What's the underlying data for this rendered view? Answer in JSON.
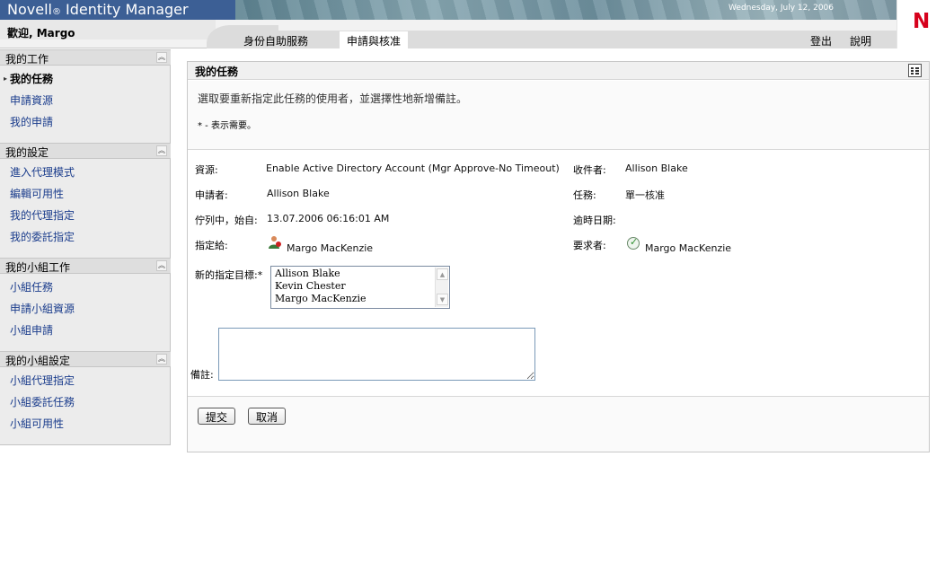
{
  "app": {
    "title": "Novell",
    "title_reg": "®",
    "title_rest": " Identity Manager",
    "date": "Wednesday, July 12, 2006",
    "logo_letter": "N"
  },
  "header": {
    "welcome": "歡迎, Margo",
    "tabs": [
      {
        "label": "身份自助服務",
        "active": false
      },
      {
        "label": "申請與核准",
        "active": true
      }
    ],
    "logout": "登出",
    "help": "說明"
  },
  "sidebar": {
    "sections": [
      {
        "title": "我的工作",
        "items": [
          "我的任務",
          "申請資源",
          "我的申請"
        ],
        "current": 0
      },
      {
        "title": "我的設定",
        "items": [
          "進入代理模式",
          "編輯可用性",
          "我的代理指定",
          "我的委託指定"
        ]
      },
      {
        "title": "我的小組工作",
        "items": [
          "小組任務",
          "申請小組資源",
          "小組申請"
        ]
      },
      {
        "title": "我的小組設定",
        "items": [
          "小組代理指定",
          "小組委託任務",
          "小組可用性"
        ]
      }
    ]
  },
  "panel": {
    "title": "我的任務",
    "instruction": "選取要重新指定此任務的使用者，並選擇性地新增備註。",
    "required_note": "* - 表示需要。",
    "fields": {
      "resource_label": "資源:",
      "resource_value": "Enable Active Directory Account (Mgr Approve-No Timeout)",
      "recipient_label": "收件者:",
      "recipient_value": "Allison Blake",
      "requester_label": "申請者:",
      "requester_value": "Allison Blake",
      "task_label": "任務:",
      "task_value": "單一核准",
      "queued_label": "佇列中，始自:",
      "queued_value": "13.07.2006 06:16:01 AM",
      "due_label": "逾時日期:",
      "due_value": "",
      "assigned_label": "指定給:",
      "assigned_value": "Margo MacKenzie",
      "claimed_label": "要求者:",
      "claimed_value": "Margo MacKenzie",
      "new_target_label": "新的指定目標:*",
      "new_target_options": [
        "Allison Blake",
        "Kevin Chester",
        "Margo MacKenzie"
      ],
      "notes_label": "備註:",
      "notes_value": ""
    },
    "buttons": {
      "submit": "提交",
      "cancel": "取消"
    }
  },
  "colors": {
    "banner_left": "#3c5f95",
    "link": "#1a3c8c",
    "logo_red": "#d6001c"
  },
  "icons": [
    "collapse-up-icon",
    "grid-icon",
    "user-icon",
    "check-icon",
    "scroll-up-icon",
    "scroll-down-icon"
  ]
}
